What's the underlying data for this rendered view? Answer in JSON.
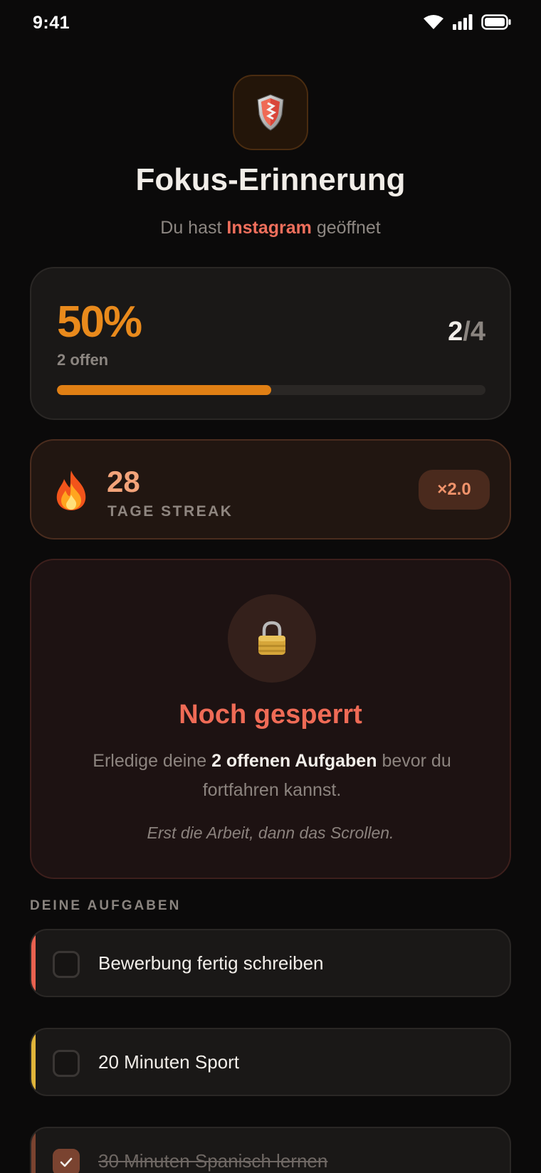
{
  "status_bar": {
    "time": "9:41"
  },
  "header": {
    "title": "Fokus-Erinnerung",
    "subtitle_prefix": "Du hast",
    "app_name": "Instagram",
    "subtitle_suffix": "geöffnet"
  },
  "progress": {
    "percent_label": "50%",
    "open_label": "2 offen",
    "done": "2",
    "slash": "/",
    "total": "4",
    "fraction": 0.5
  },
  "streak": {
    "days": "28",
    "label": "TAGE STREAK",
    "multiplier": "×2.0"
  },
  "lock": {
    "title": "Noch gesperrt",
    "text_prefix": "Erledige deine",
    "text_bold": "2 offenen Aufgaben",
    "text_suffix": "bevor du fortfahren kannst.",
    "quote": "Erst die Arbeit, dann das Scrollen."
  },
  "tasks_section": {
    "label": "DEINE AUFGABEN",
    "items": [
      {
        "label": "Bewerbung fertig schreiben",
        "checked": false,
        "accent": "#e8614f"
      },
      {
        "label": "20 Minuten Sport",
        "checked": false,
        "accent": "#e0b43a"
      },
      {
        "label": "30 Minuten Spanisch lernen",
        "checked": true,
        "accent": "#7a4330"
      }
    ]
  },
  "colors": {
    "accent_orange": "#e98a1c",
    "streak_orange": "#f2a37a",
    "lock_red": "#ef6b56"
  }
}
